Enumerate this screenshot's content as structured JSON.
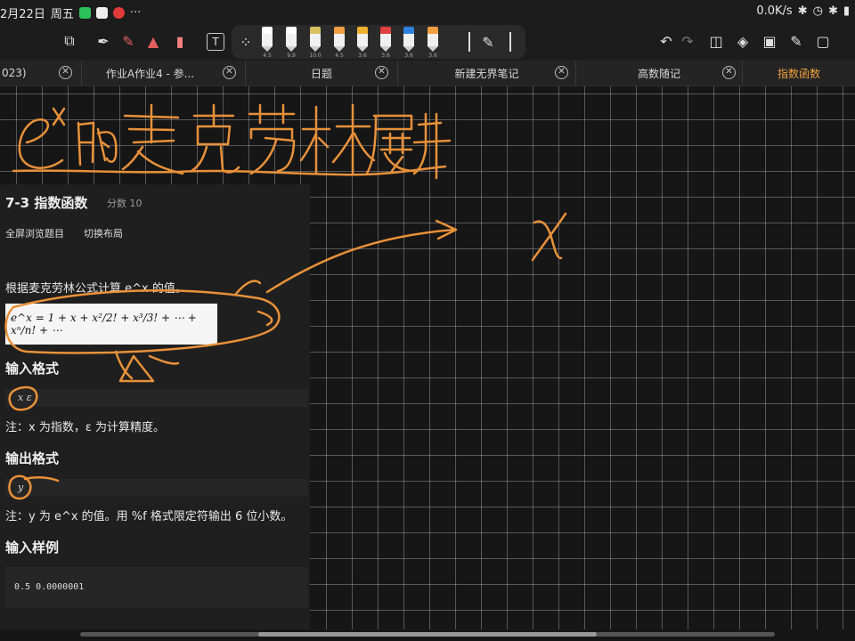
{
  "status_bar": {
    "date": "2月22日",
    "weekday": "周五",
    "more_dots": "···",
    "network_speed": "0.0K/s"
  },
  "toolbar": {
    "text_tool_label": "T",
    "pen_sizes": [
      "4.5",
      "9.9",
      "10.0",
      "4.5",
      "3.6",
      "3.6",
      "3.6",
      "3.6"
    ],
    "pen_colors": [
      "#ffffff",
      "#ffffff",
      "#d8c060",
      "#f0a040",
      "#f0b030",
      "#e04040",
      "#3080e0",
      "#f0a040"
    ]
  },
  "tabs": [
    {
      "label": "023)",
      "active": false
    },
    {
      "label": "作业A作业4 - 参...",
      "active": false
    },
    {
      "label": "日题",
      "active": false
    },
    {
      "label": "新建无界笔记",
      "active": false
    },
    {
      "label": "高数随记",
      "active": false
    },
    {
      "label": "指数函数",
      "active": true
    }
  ],
  "problem": {
    "title": "7-3 指数函数",
    "score": "分数 10",
    "actions": [
      "全屏浏览题目",
      "切换布局"
    ],
    "description": "根据麦克劳林公式计算 e^x 的值。",
    "formula": "e^x = 1 + x + x²/2! + x³/3! + ⋯ + xⁿ/n! + ⋯",
    "input_heading": "输入格式",
    "input_format": "x ε",
    "input_note": "注：x 为指数，ε 为计算精度。",
    "output_heading": "输出格式",
    "output_format": "y",
    "output_note": "注：y 为 e^x 的值。用 %f 格式限定符输出 6 位小数。",
    "sample_input_heading": "输入样例",
    "sample_input": "0.5 0.0000001"
  },
  "colors": {
    "ink": "#e8913a",
    "active_tab": "#f0a040",
    "background": "#161616"
  }
}
